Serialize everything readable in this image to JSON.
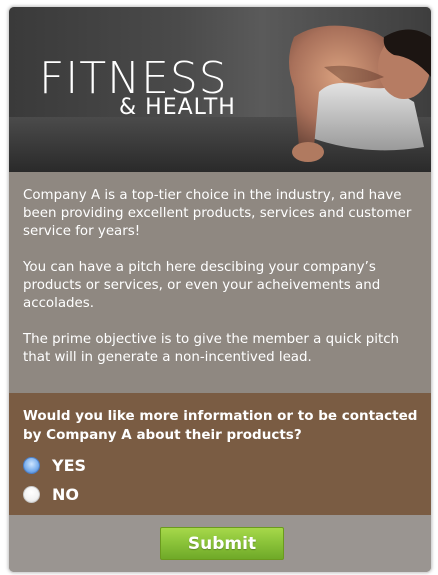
{
  "hero": {
    "logo_main": "FITNESS",
    "logo_sub": "& HEALTH",
    "image_icon": "man-doing-pushup-photo"
  },
  "content": {
    "paragraphs": [
      "Company A is a top-tier choice in the industry, and have been providing excellent products, services and customer service for years!",
      "You can have a pitch here descibing your company’s products or services, or even your acheivements and accolades.",
      "The prime objective is to give the member a quick pitch that will in generate a non-incentived lead."
    ]
  },
  "form": {
    "question": "Would you like more information or to be contacted by Company A about their products?",
    "options": [
      {
        "label": "YES",
        "selected": true
      },
      {
        "label": "NO",
        "selected": false
      }
    ],
    "submit_label": "Submit"
  },
  "colors": {
    "body_bg": "#8f8881",
    "question_bg": "#7a5c43",
    "submit_green": "#8cc43a",
    "radio_selected": "#7fb2ee"
  }
}
